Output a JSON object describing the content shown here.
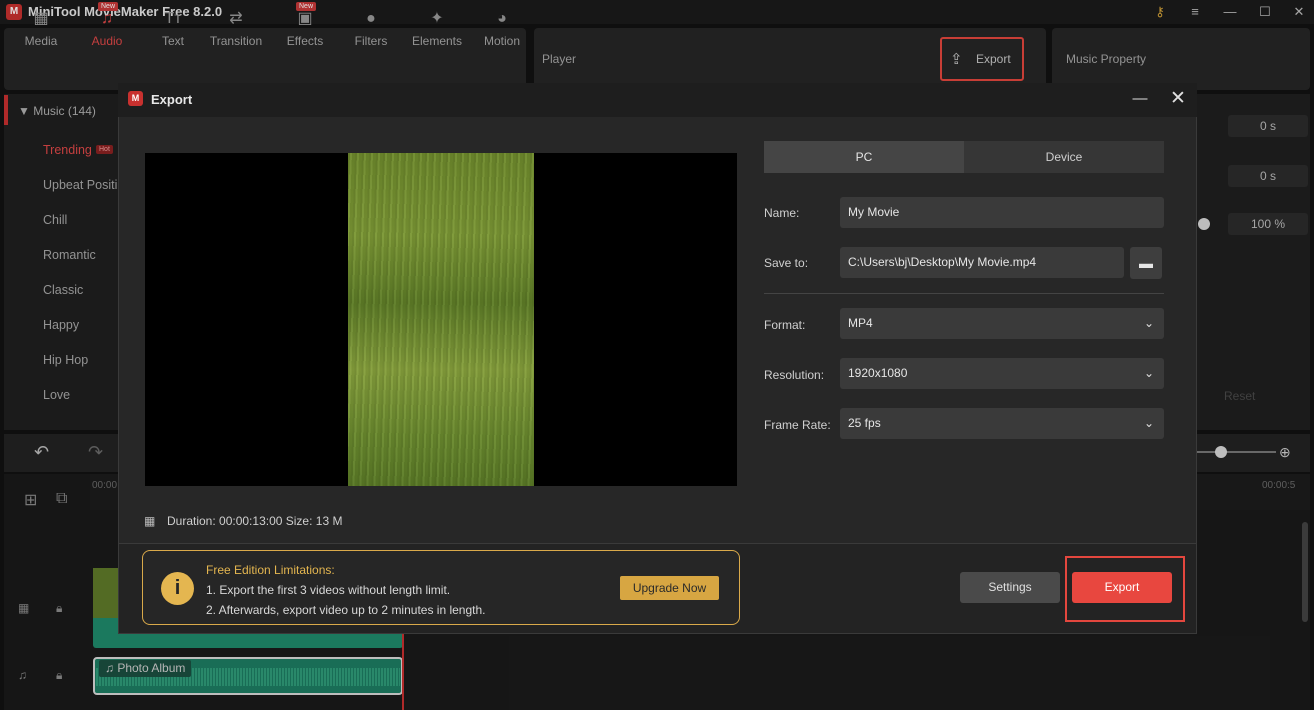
{
  "app": {
    "title": "MiniTool MovieMaker Free 8.2.0",
    "logo": "M"
  },
  "window_controls": {
    "key_icon": "⚷",
    "menu_icon": "≡",
    "minimize_icon": "—",
    "maximize_icon": "☐",
    "close_icon": "✕"
  },
  "toolbar": {
    "items": [
      {
        "label": "Media",
        "icon": "▦"
      },
      {
        "label": "Audio",
        "icon": "♫",
        "badge": "New"
      },
      {
        "label": "Text",
        "icon": "Tт"
      },
      {
        "label": "Transition",
        "icon": "⇄"
      },
      {
        "label": "Effects",
        "icon": "▣",
        "badge": "New"
      },
      {
        "label": "Filters",
        "icon": "●"
      },
      {
        "label": "Elements",
        "icon": "✦"
      },
      {
        "label": "Motion",
        "icon": "◕"
      }
    ]
  },
  "player": {
    "label": "Player",
    "export_label": "Export",
    "export_icon": "⇪"
  },
  "property": {
    "label": "Music Property",
    "values": [
      "0 s",
      "0 s",
      "100 %"
    ],
    "reset_label": "Reset"
  },
  "music_list": {
    "category": "▼  Music (144)",
    "hot_badge": "Hot",
    "genres": [
      "Trending",
      "Upbeat Positi",
      "Chill",
      "Romantic",
      "Classic",
      "Happy",
      "Hip Hop",
      "Love"
    ]
  },
  "timeline": {
    "ruler_start": "00:00",
    "ruler_end": "00:00:5",
    "audio_clip_label": "♫ Photo Album"
  },
  "dialog": {
    "title": "Export",
    "logo": "M",
    "minimize_icon": "—",
    "close_icon": "✕",
    "tabs": {
      "pc": "PC",
      "device": "Device"
    },
    "name_label": "Name:",
    "name_value": "My Movie",
    "save_label": "Save to:",
    "save_value": "C:\\Users\\bj\\Desktop\\My Movie.mp4",
    "folder_icon": "▬",
    "format_label": "Format:",
    "format_value": "MP4",
    "resolution_label": "Resolution:",
    "resolution_value": "1920x1080",
    "framerate_label": "Frame Rate:",
    "framerate_value": "25 fps",
    "chevron_icon": "⌄",
    "duration_text": "Duration:  00:00:13:00  Size:  13 M",
    "film_icon": "▦",
    "limitations": {
      "icon": "i",
      "title": "Free Edition Limitations:",
      "line1": "1. Export the first 3 videos without length limit.",
      "line2": "2. Afterwards, export video up to 2 minutes in length.",
      "upgrade_label": "Upgrade Now"
    },
    "settings_label": "Settings",
    "export_label": "Export"
  }
}
